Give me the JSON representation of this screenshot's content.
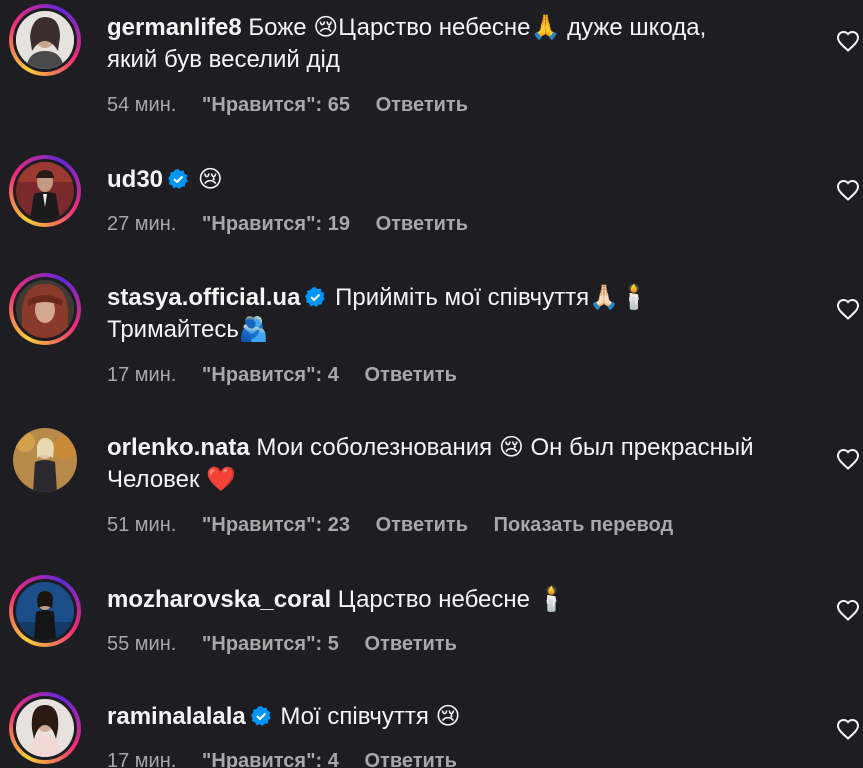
{
  "comments": [
    {
      "username": "germanlife8",
      "verified": false,
      "text": "Боже 😢Царство небесне🙏 дуже шкода,",
      "text_line2": "який був веселий дід",
      "time": "54 мин.",
      "likes": "\"Нравится\": 65",
      "reply": "Ответить",
      "translate": ""
    },
    {
      "username": "ud30",
      "verified": true,
      "text": "😢",
      "text_line2": "",
      "time": "27 мин.",
      "likes": "\"Нравится\": 19",
      "reply": "Ответить",
      "translate": ""
    },
    {
      "username": "stasya.official.ua",
      "verified": true,
      "text": "Прийміть мої співчуття🙏🏻🕯️",
      "text_line2": "Тримайтесь🫂",
      "time": "17 мин.",
      "likes": "\"Нравится\": 4",
      "reply": "Ответить",
      "translate": ""
    },
    {
      "username": "orlenko.nata",
      "verified": false,
      "text": "Мои соболезнования 😢 Он был прекрасный",
      "text_line2": "Человек ❤️",
      "time": "51 мин.",
      "likes": "\"Нравится\": 23",
      "reply": "Ответить",
      "translate": "Показать перевод"
    },
    {
      "username": "mozharovska_coral",
      "verified": false,
      "text": "Царство небесне 🕯️",
      "text_line2": "",
      "time": "55 мин.",
      "likes": "\"Нравится\": 5",
      "reply": "Ответить",
      "translate": ""
    },
    {
      "username": "raminalalala",
      "verified": true,
      "text": "Мої співчуття 😢",
      "text_line2": "",
      "time": "17 мин.",
      "likes": "\"Нравится\": 4",
      "reply": "Ответить",
      "translate": ""
    }
  ],
  "icons": {
    "like": "heart-outline-icon",
    "verified": "verified-badge-icon"
  },
  "colors": {
    "background": "#1d1d22",
    "text": "#f5f5f5",
    "meta": "#a8a8a8",
    "verified": "#0095f6"
  }
}
